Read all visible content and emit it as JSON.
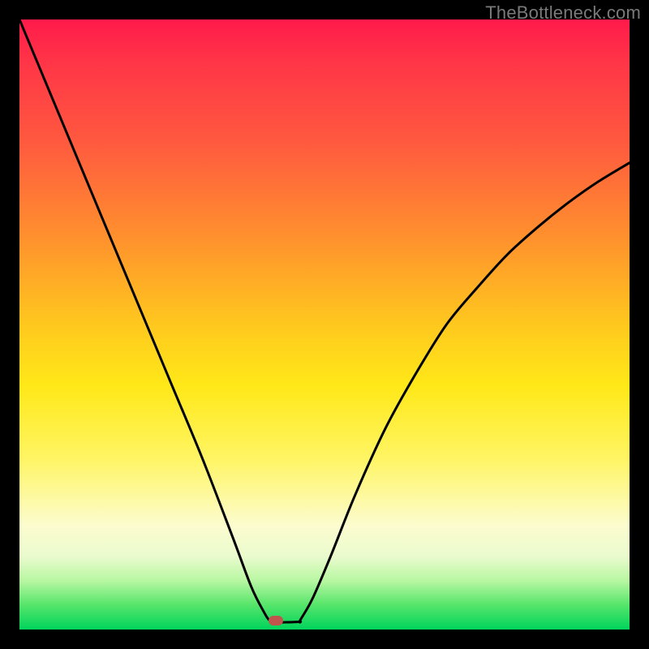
{
  "watermark": {
    "text": "TheBottleneck.com"
  },
  "colors": {
    "frame": "#000000",
    "curve": "#000000",
    "marker": "#c1554d",
    "gradient_stops": [
      "#ff1a4b",
      "#ff3547",
      "#ff593f",
      "#ff8e2e",
      "#ffc81e",
      "#ffe818",
      "#fff564",
      "#fcfccf",
      "#eafbce",
      "#b8f7a2",
      "#55e56a",
      "#00d45c"
    ]
  },
  "chart_data": {
    "type": "line",
    "title": "",
    "xlabel": "",
    "ylabel": "",
    "xlim": [
      0,
      100
    ],
    "ylim": [
      0,
      100
    ],
    "grid": false,
    "legend": false,
    "marker": {
      "x": 42,
      "y": 1.5
    },
    "series": [
      {
        "name": "left-branch",
        "x": [
          0,
          5,
          10,
          15,
          20,
          25,
          30,
          35,
          38,
          40,
          41,
          42
        ],
        "y": [
          100,
          88,
          76,
          64,
          52,
          40,
          28,
          15,
          7,
          3,
          1.5,
          1.2
        ]
      },
      {
        "name": "flat-bottom",
        "x": [
          42,
          44,
          46
        ],
        "y": [
          1.2,
          1.2,
          1.3
        ]
      },
      {
        "name": "right-branch",
        "x": [
          46,
          48,
          51,
          55,
          60,
          65,
          70,
          75,
          80,
          85,
          90,
          95,
          100
        ],
        "y": [
          1.5,
          5,
          12,
          22,
          33,
          42,
          50,
          56,
          61.5,
          66,
          70,
          73.5,
          76.5
        ]
      }
    ]
  }
}
